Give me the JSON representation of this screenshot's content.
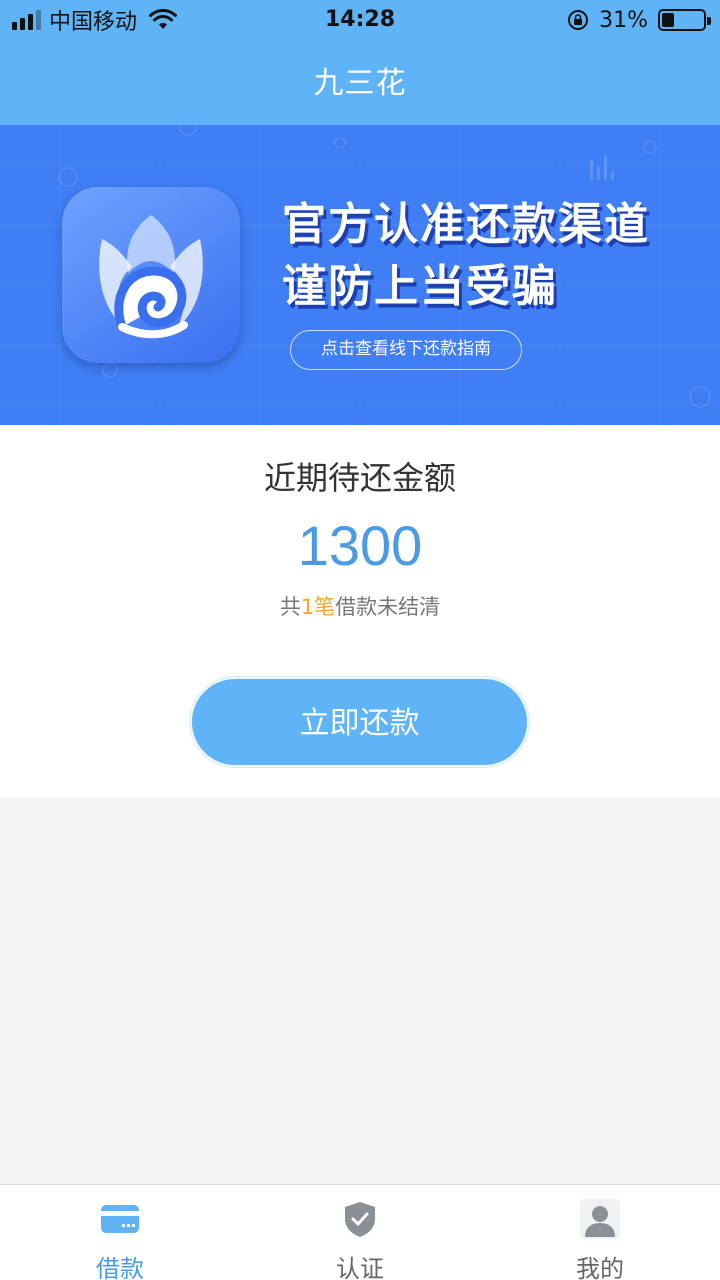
{
  "status_bar": {
    "carrier": "中国移动",
    "time": "14:28",
    "battery_text": "31%",
    "battery_level": 0.31
  },
  "nav": {
    "title": "九三花"
  },
  "banner": {
    "headline_1": "官方认准还款渠道",
    "headline_2": "谨防上当受骗",
    "guide_link": "点击查看线下还款指南",
    "bg_color": "#3f7ef5"
  },
  "repayment": {
    "title": "近期待还金额",
    "amount": "1300",
    "note_prefix": "共",
    "note_count": "1笔",
    "note_suffix": "借款未结清",
    "button_label": "立即还款",
    "accent_color": "#4a9ae6",
    "highlight_color": "#f5a623"
  },
  "tab_bar": {
    "items": [
      {
        "label": "借款",
        "icon": "card-icon",
        "active": true
      },
      {
        "label": "认证",
        "icon": "shield-check-icon",
        "active": false
      },
      {
        "label": "我的",
        "icon": "user-icon",
        "active": false
      }
    ]
  }
}
